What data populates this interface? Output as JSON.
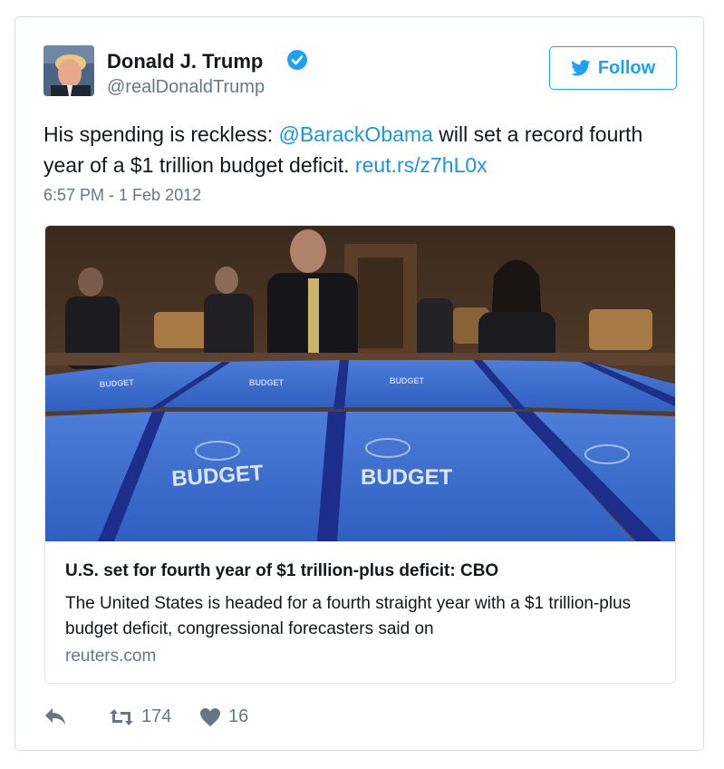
{
  "user": {
    "display_name": "Donald J. Trump",
    "handle": "@realDonaldTrump",
    "verified": true
  },
  "follow": {
    "label": "Follow"
  },
  "tweet": {
    "text_before": "His spending is reckless: ",
    "mention": "@BarackObama",
    "text_middle": " will set a record fourth year of a $1 trillion budget deficit. ",
    "link": "reut.rs/z7hL0x",
    "timestamp": "6:57 PM - 1 Feb 2012"
  },
  "card": {
    "image_alt": "Stacks of fiscal year 2012 budget books",
    "book_label": "BUDGET",
    "title": "U.S. set for fourth year of $1 trillion-plus deficit: CBO",
    "description": "The United States is headed for a fourth straight year with a $1 trillion-plus budget deficit, congressional forecasters said on",
    "domain": "reuters.com"
  },
  "actions": {
    "retweets": "174",
    "likes": "16"
  },
  "colors": {
    "link": "#1b95e0",
    "follow": "#1da1f2",
    "muted": "#657786"
  },
  "icons": [
    "verified-icon",
    "twitter-bird-icon",
    "reply-icon",
    "retweet-icon",
    "heart-icon"
  ]
}
